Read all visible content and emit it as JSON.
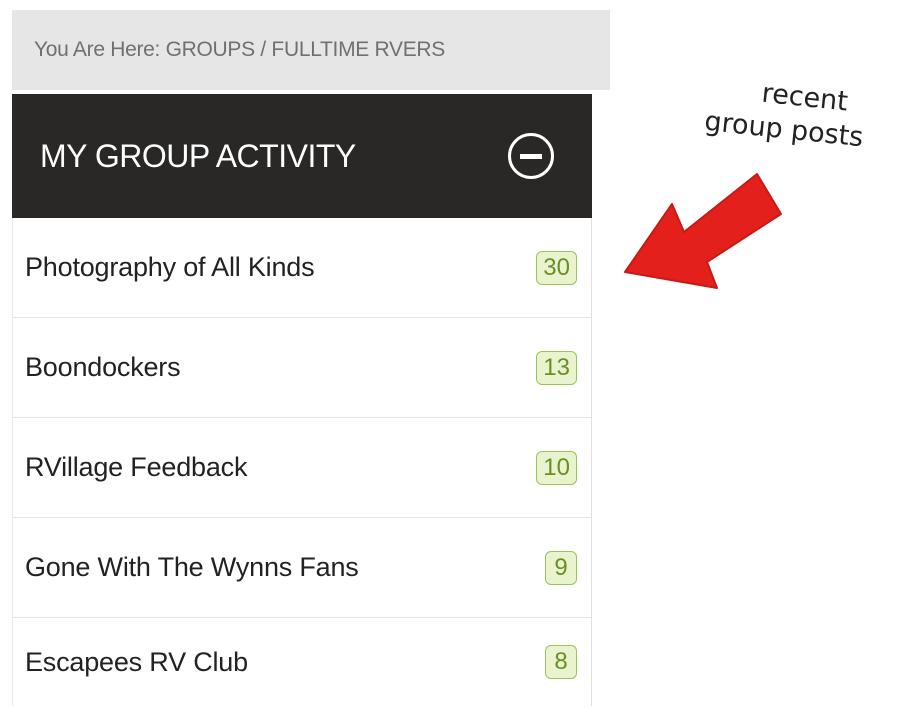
{
  "breadcrumb": {
    "text": "You Are Here: GROUPS / FULLTIME RVERS"
  },
  "panel": {
    "title": "MY GROUP ACTIVITY",
    "collapse_icon": "minus-circle-icon",
    "header_color": "#2a2827",
    "items": [
      {
        "label": "Photography of All Kinds",
        "count": "30"
      },
      {
        "label": "Boondockers",
        "count": "13"
      },
      {
        "label": "RVillage Feedback",
        "count": "10"
      },
      {
        "label": "Gone With The Wynns Fans",
        "count": "9"
      },
      {
        "label": "Escapees RV Club",
        "count": "8"
      }
    ],
    "badge_colors": {
      "background": "#e9f4cf",
      "border": "#9bc35a",
      "text": "#6a8f23"
    }
  },
  "annotation": {
    "line1": "recent",
    "line2": "group posts",
    "arrow_icon": "red-arrow-icon",
    "arrow_color": "#e3201b"
  }
}
